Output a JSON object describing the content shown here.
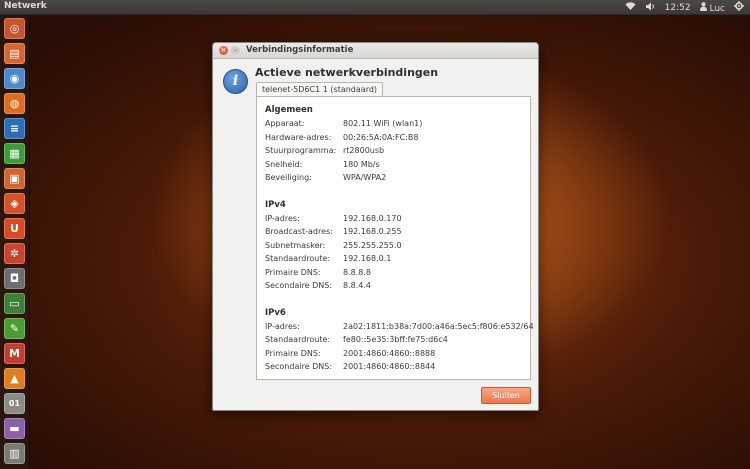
{
  "topbar": {
    "app_title": "Netwerk",
    "time": "12:52",
    "user": "Luc",
    "icons": [
      "wifi-icon",
      "volume-icon",
      "user-icon",
      "gear-icon"
    ]
  },
  "launcher": {
    "items": [
      {
        "name": "ubuntu-dash-icon",
        "glyph": "◎",
        "color": "#c9532a"
      },
      {
        "name": "files-icon",
        "glyph": "▤",
        "color": "#d8652f"
      },
      {
        "name": "chromium-icon",
        "glyph": "◉",
        "color": "#4b8ac9"
      },
      {
        "name": "firefox-icon",
        "glyph": "◍",
        "color": "#e06c1e"
      },
      {
        "name": "writer-icon",
        "glyph": "≡",
        "color": "#2d6fb7"
      },
      {
        "name": "calc-icon",
        "glyph": "▦",
        "color": "#3e9b3a"
      },
      {
        "name": "impress-icon",
        "glyph": "▣",
        "color": "#d0662c"
      },
      {
        "name": "software-center-icon",
        "glyph": "◈",
        "color": "#d2532a"
      },
      {
        "name": "ubuntu-one-icon",
        "glyph": "U",
        "color": "#d84b22"
      },
      {
        "name": "settings-icon",
        "glyph": "✲",
        "color": "#c8452c"
      },
      {
        "name": "camera-icon",
        "glyph": "◘",
        "color": "#6d6d6d"
      },
      {
        "name": "monitor-icon",
        "glyph": "▭",
        "color": "#3f7f3a"
      },
      {
        "name": "notes-icon",
        "glyph": "✎",
        "color": "#4d9c33"
      },
      {
        "name": "mail-icon",
        "glyph": "M",
        "color": "#c83b2f"
      },
      {
        "name": "vlc-icon",
        "glyph": "▲",
        "color": "#e07d1e"
      },
      {
        "name": "binary-icon",
        "glyph": "01",
        "color": "#8a8a86"
      },
      {
        "name": "usb-icon",
        "glyph": "▬",
        "color": "#8c5fa8"
      },
      {
        "name": "trash-icon",
        "glyph": "▥",
        "color": "#7a7974"
      }
    ]
  },
  "dialog": {
    "title": "Verbindingsinformatie",
    "heading": "Actieve netwerkverbindingen",
    "tab_label": "telenet-5D6C1 1 (standaard)",
    "close_button": "Sluiten",
    "sections": [
      {
        "title": "Algemeen",
        "rows": [
          {
            "label": "Apparaat:",
            "value": "802.11 WiFi (wlan1)"
          },
          {
            "label": "Hardware-adres:",
            "value": "00:26:5A:0A:FC:B8"
          },
          {
            "label": "Stuurprogramma:",
            "value": "rt2800usb"
          },
          {
            "label": "Snelheid:",
            "value": "180 Mb/s"
          },
          {
            "label": "Beveiliging:",
            "value": "WPA/WPA2"
          }
        ]
      },
      {
        "title": "IPv4",
        "rows": [
          {
            "label": "IP-adres:",
            "value": "192.168.0.170"
          },
          {
            "label": "Broadcast-adres:",
            "value": "192.168.0.255"
          },
          {
            "label": "Subnetmasker:",
            "value": "255.255.255.0"
          },
          {
            "label": "Standaardroute:",
            "value": "192.168.0.1"
          },
          {
            "label": "Primaire DNS:",
            "value": "8.8.8.8"
          },
          {
            "label": "Secondaire DNS:",
            "value": "8.8.4.4"
          }
        ]
      },
      {
        "title": "IPv6",
        "rows": [
          {
            "label": "IP-adres:",
            "value": "2a02:1811:b38a:7d00:a46a:5ec5:f806:e532/64"
          },
          {
            "label": "Standaardroute:",
            "value": "fe80::5e35:3bff:fe75:d6c4"
          },
          {
            "label": "Primaire DNS:",
            "value": "2001:4860:4860::8888"
          },
          {
            "label": "Secondaire DNS:",
            "value": "2001:4860:4860::8844"
          }
        ]
      }
    ]
  }
}
